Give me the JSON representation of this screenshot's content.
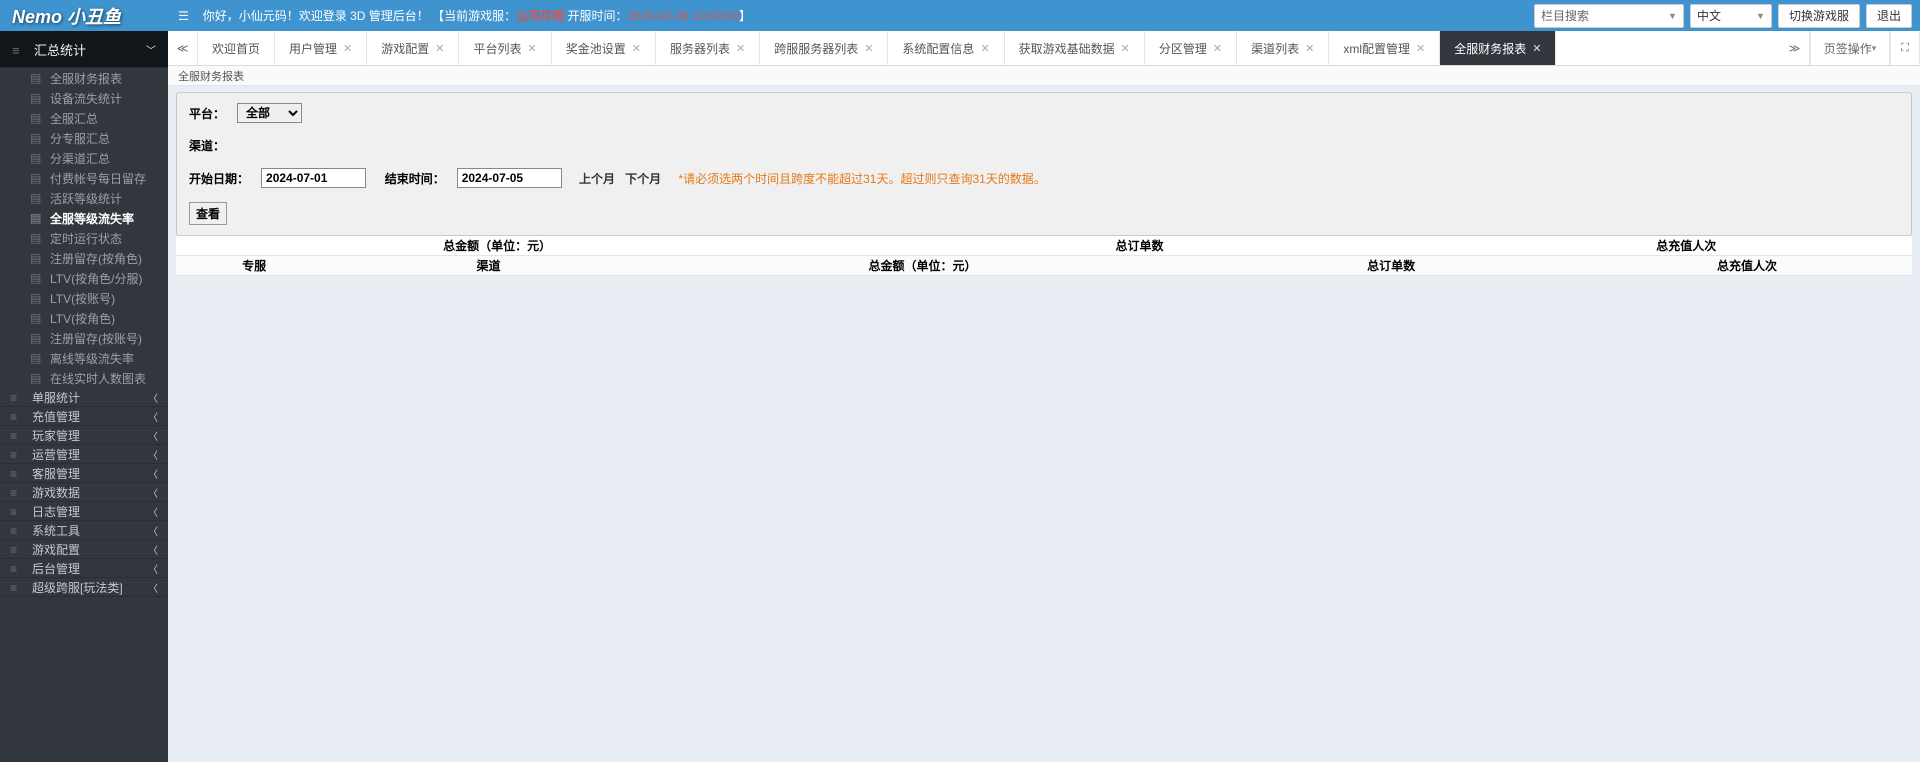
{
  "logo": "Nemo 小丑鱼",
  "welcome": {
    "prefix": "你好，小仙元码！欢迎登录 3D 管理后台！",
    "game_label": "【当前游戏服：",
    "game_name": "山河月明",
    "open_label": " 开服时间：",
    "open_time": "2020-02-09 10:00:00",
    "suffix": "】"
  },
  "top": {
    "search_placeholder": "栏目搜索",
    "lang": "中文",
    "switch_server": "切换游戏服",
    "logout": "退出"
  },
  "sidebar": {
    "summary": "汇总统计",
    "items": [
      "全服财务报表",
      "设备流失统计",
      "全服汇总",
      "分专服汇总",
      "分渠道汇总",
      "付费帐号每日留存",
      "活跃等级统计",
      "全服等级流失率",
      "定时运行状态",
      "注册留存(按角色)",
      "LTV(按角色/分服)",
      "LTV(按账号)",
      "LTV(按角色)",
      "注册留存(按账号)",
      "离线等级流失率",
      "在线实时人数图表"
    ],
    "active_index": 7,
    "cats": [
      "单服统计",
      "充值管理",
      "玩家管理",
      "运营管理",
      "客服管理",
      "游戏数据",
      "日志管理",
      "系统工具",
      "游戏配置",
      "后台管理",
      "超级跨服[玩法类]"
    ]
  },
  "tabs": {
    "ops": "页签操作",
    "items": [
      {
        "label": "欢迎首页",
        "closable": false
      },
      {
        "label": "用户管理",
        "closable": true
      },
      {
        "label": "游戏配置",
        "closable": true
      },
      {
        "label": "平台列表",
        "closable": true
      },
      {
        "label": "奖金池设置",
        "closable": true
      },
      {
        "label": "服务器列表",
        "closable": true
      },
      {
        "label": "跨服服务器列表",
        "closable": true
      },
      {
        "label": "系统配置信息",
        "closable": true
      },
      {
        "label": "获取游戏基础数据",
        "closable": true
      },
      {
        "label": "分区管理",
        "closable": true
      },
      {
        "label": "渠道列表",
        "closable": true
      },
      {
        "label": "xml配置管理",
        "closable": true
      },
      {
        "label": "全服财务报表",
        "closable": true
      }
    ],
    "active_index": 12
  },
  "crumb": "全服财务报表",
  "filter": {
    "platform_label": "平台：",
    "platform_value": "全部",
    "channel_label": "渠道：",
    "start_label": "开始日期：",
    "start_value": "2024-07-01",
    "end_label": "结束时间：",
    "end_value": "2024-07-05",
    "prev_month": "上个月",
    "next_month": "下个月",
    "warn": "*请必须选两个时间且跨度不能超过31天。超过则只查询31天的数据。",
    "search_btn": "查看"
  },
  "table": {
    "head1": [
      "总金额（单位：元）",
      "总订单数",
      "总充值人次"
    ],
    "head2": [
      "专服",
      "渠道",
      "总金额（单位：元）",
      "总订单数",
      "总充值人次"
    ]
  }
}
